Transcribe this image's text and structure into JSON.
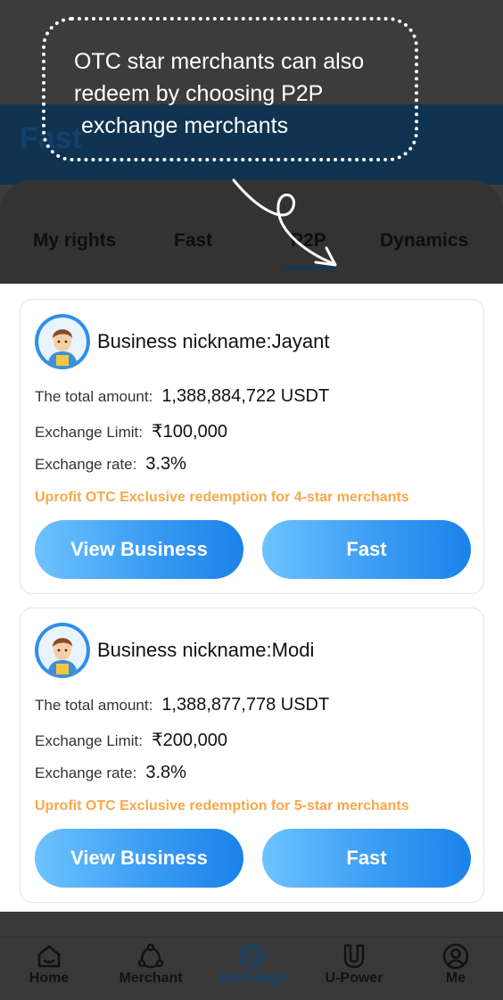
{
  "header": {
    "title": "Fast"
  },
  "tabs": [
    {
      "label": "My rights"
    },
    {
      "label": "Fast"
    },
    {
      "label": "P2P"
    },
    {
      "label": "Dynamics"
    }
  ],
  "active_tab": "P2P",
  "tooltip": {
    "line1": "OTC star merchants can also",
    "line2": "redeem by choosing P2P",
    "line3": "exchange merchants"
  },
  "merchants": [
    {
      "nickname": "Business nickname:Jayant",
      "total_label": "The total amount:",
      "total_value": "1,388,884,722 USDT",
      "limit_label": "Exchange Limit:",
      "limit_value": "₹100,000",
      "rate_label": "Exchange rate:",
      "rate_value": "3.3%",
      "exclusive_note": "Uprofit OTC Exclusive redemption for 4-star merchants",
      "view_button": "View Business",
      "fast_button": "Fast"
    },
    {
      "nickname": "Business nickname:Modi",
      "total_label": "The total amount:",
      "total_value": "1,388,877,778 USDT",
      "limit_label": "Exchange Limit:",
      "limit_value": "₹200,000",
      "rate_label": "Exchange rate:",
      "rate_value": "3.8%",
      "exclusive_note": "Uprofit OTC Exclusive redemption for 5-star merchants",
      "view_button": "View Business",
      "fast_button": "Fast"
    }
  ],
  "bottom_nav": [
    {
      "label": "Home",
      "icon": "home-icon"
    },
    {
      "label": "Merchant",
      "icon": "merchant-icon"
    },
    {
      "label": "Exchange",
      "icon": "exchange-icon"
    },
    {
      "label": "U-Power",
      "icon": "u-power-icon"
    },
    {
      "label": "Me",
      "icon": "profile-icon"
    }
  ],
  "active_nav": "Exchange",
  "colors": {
    "accent_blue": "#2d8fe9",
    "button_gradient_start": "#6ec3ff",
    "button_gradient_end": "#1a82ea",
    "exclusive_note": "#f7a84a",
    "active_nav": "#0f4270"
  }
}
